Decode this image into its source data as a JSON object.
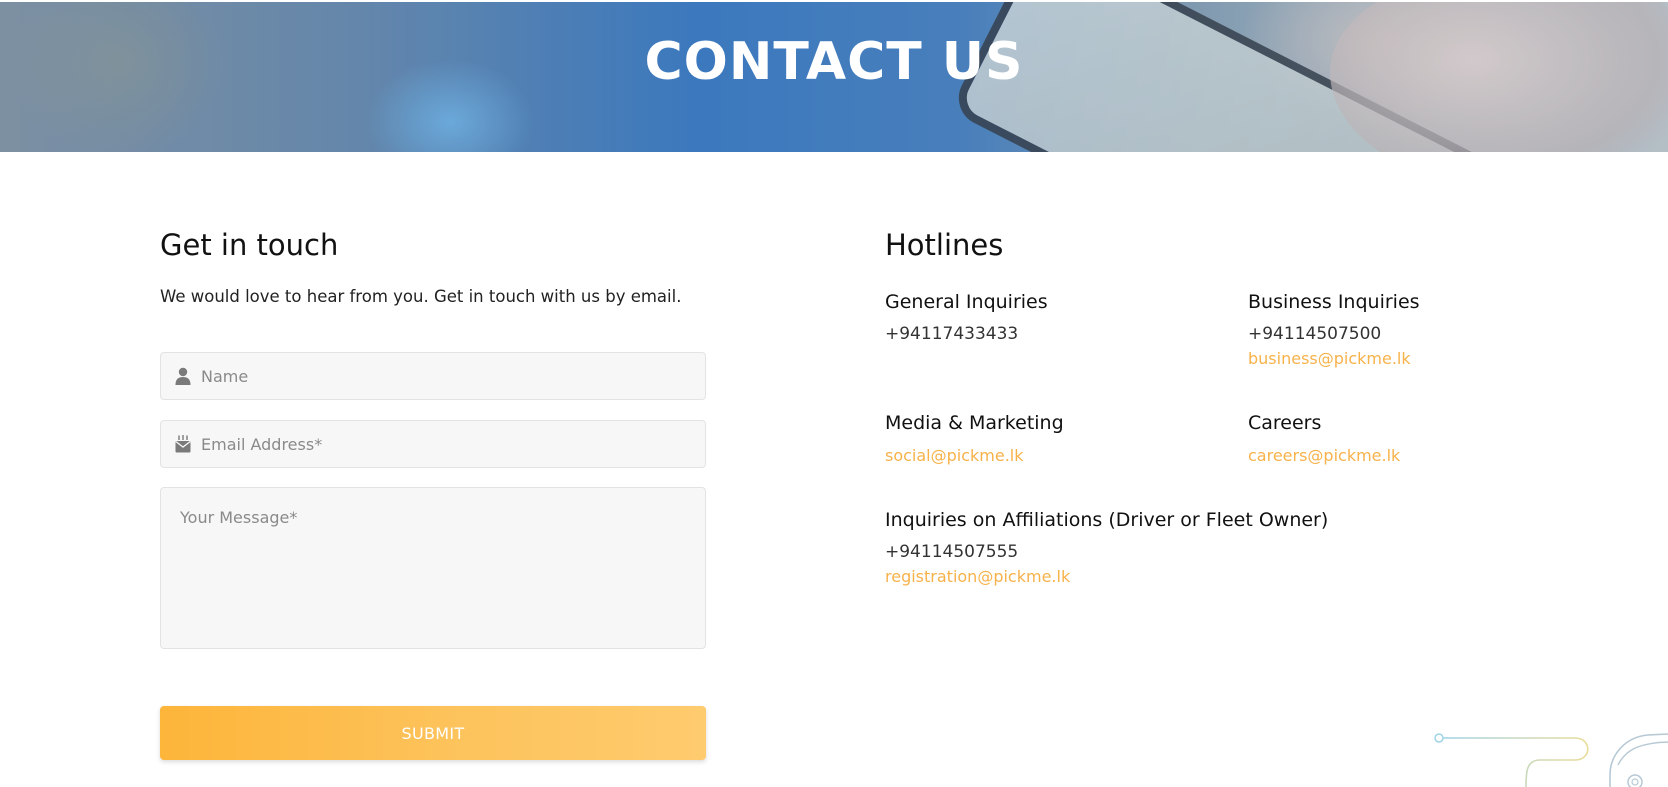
{
  "hero": {
    "title": "CONTACT US"
  },
  "contact_form": {
    "heading": "Get in touch",
    "intro": "We would love to hear from you. Get in touch with us by email.",
    "name_placeholder": "Name",
    "email_placeholder": "Email Address*",
    "message_placeholder": "Your Message*",
    "submit_label": "SUBMIT"
  },
  "hotlines": {
    "heading": "Hotlines",
    "general": {
      "label": "General Inquiries",
      "phone": "+94117433433"
    },
    "business": {
      "label": "Business Inquiries",
      "phone": "+94114507500",
      "email": "business@pickme.lk"
    },
    "media": {
      "label": "Media & Marketing",
      "email": "social@pickme.lk"
    },
    "careers": {
      "label": "Careers",
      "email": "careers@pickme.lk"
    },
    "affiliations": {
      "label": "Inquiries on Affiliations (Driver or Fleet Owner)",
      "phone": "+94114507555",
      "email": "registration@pickme.lk"
    }
  },
  "colors": {
    "accent": "#f7b24a",
    "button_start": "#fdb53a",
    "button_end": "#fecb6e"
  },
  "icons": {
    "name_field": "user-icon",
    "email_field": "mail-icon"
  }
}
